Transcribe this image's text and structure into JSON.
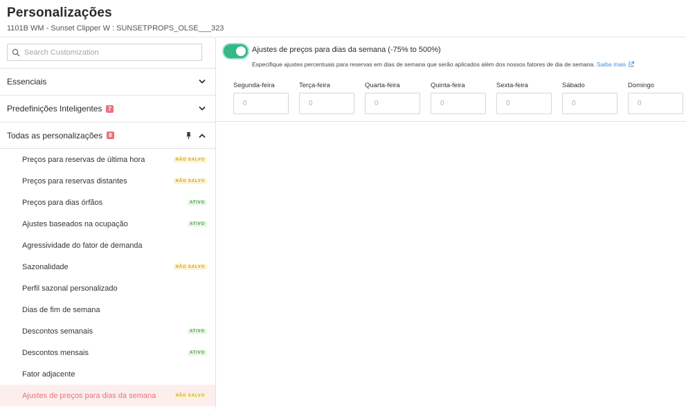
{
  "header": {
    "title": "Personalizações",
    "subtitle": "1101B WM - Sunset Clipper W : SUNSETPROPS_OLSE___323"
  },
  "search": {
    "placeholder": "Search Customization",
    "value": ""
  },
  "sections": [
    {
      "label": "Essenciais",
      "expanded": false,
      "badge": null
    },
    {
      "label": "Predefinições Inteligentes",
      "expanded": false,
      "badge": "7"
    },
    {
      "label": "Todas as personalizações",
      "expanded": true,
      "badge": "8"
    }
  ],
  "items": [
    {
      "label": "Preços para reservas de última hora",
      "status": "NÃO SALVO"
    },
    {
      "label": "Preços para reservas distantes",
      "status": "NÃO SALVO"
    },
    {
      "label": "Preços para dias órfãos",
      "status": "ATIVO"
    },
    {
      "label": "Ajustes baseados na ocupação",
      "status": "ATIVO"
    },
    {
      "label": "Agressividade do fator de demanda",
      "status": ""
    },
    {
      "label": "Sazonalidade",
      "status": "NÃO SALVO"
    },
    {
      "label": "Perfil sazonal personalizado",
      "status": ""
    },
    {
      "label": "Dias de fim de semana",
      "status": ""
    },
    {
      "label": "Descontos semanais",
      "status": "ATIVO"
    },
    {
      "label": "Descontos mensais",
      "status": "ATIVO"
    },
    {
      "label": "Fator adjacente",
      "status": ""
    },
    {
      "label": "Ajustes de preços para dias da semana",
      "status": "NÃO SALVO",
      "selected": true
    }
  ],
  "main": {
    "toggle_on": true,
    "title": "Ajustes de preços para dias da semana (-75% to 500%)",
    "description": "Especifique ajustes percentuais para reservas em dias de semana que serão aplicados além dos nossos fatores de dia de semana.",
    "learn_more": "Saiba mais",
    "days": [
      {
        "label": "Segunda-feira",
        "placeholder": "0"
      },
      {
        "label": "Terça-feira",
        "placeholder": "0"
      },
      {
        "label": "Quarta-feira",
        "placeholder": "0"
      },
      {
        "label": "Quinta-feira",
        "placeholder": "0"
      },
      {
        "label": "Sexta-feira",
        "placeholder": "0"
      },
      {
        "label": "Sábado",
        "placeholder": "0"
      },
      {
        "label": "Domingo",
        "placeholder": "0"
      }
    ]
  },
  "colors": {
    "accent_toggle": "#33b986",
    "badge": "#e8737a",
    "selected_text": "#e5737a",
    "selected_bg": "#fdeeee",
    "unsaved_text": "#d3a316",
    "active_text": "#3b9c35",
    "link": "#3d8fd6"
  },
  "icons": {
    "search": "search-icon",
    "chevron_down": "chevron-down-icon",
    "chevron_up": "chevron-up-icon",
    "pin": "pin-icon",
    "external": "external-link-icon"
  }
}
